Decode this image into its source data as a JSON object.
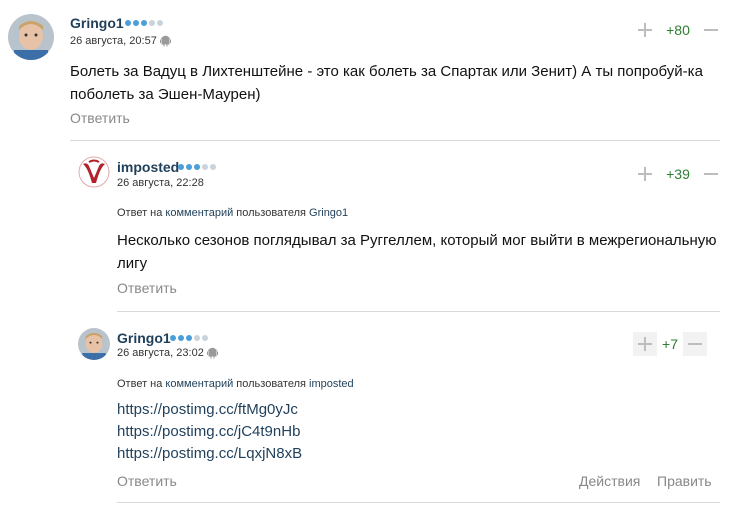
{
  "comments": [
    {
      "user": "Gringo1",
      "date": "26 августа, 20:57",
      "score": "+80",
      "text": "Болеть за Вадуц в Лихтенштейне - это как болеть за Спартак или Зенит) А ты попробуй-ка поболеть за Эшен-Маурен)",
      "reply_label": "Ответить"
    },
    {
      "user": "imposted",
      "date": "26 августа, 22:28",
      "score": "+39",
      "reply_to": {
        "prefix": "Ответ на",
        "link": "комментарий",
        "middle": "пользователя",
        "user": "Gringo1"
      },
      "text": "Несколько сезонов поглядывал за Руггеллем, который мог выйти в межрегиональную лигу",
      "reply_label": "Ответить"
    },
    {
      "user": "Gringo1",
      "date": "26 августа, 23:02",
      "score": "+7",
      "reply_to": {
        "prefix": "Ответ на",
        "link": "комментарий",
        "middle": "пользователя",
        "user": "imposted"
      },
      "links": [
        "https://postimg.cc/ftMg0yJc",
        "https://postimg.cc/jC4t9nHb",
        "https://postimg.cc/LqxjN8xB"
      ],
      "reply_label": "Ответить",
      "actions_label": "Действия",
      "edit_label": "Править"
    }
  ],
  "colors": {
    "dot_active": "#4a9fd8",
    "dot_inactive": "#c9d3dc",
    "score": "#2e7d32",
    "username": "#1f3f5a"
  }
}
